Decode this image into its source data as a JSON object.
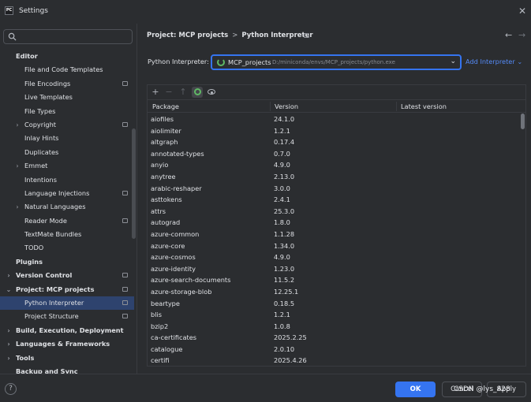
{
  "window": {
    "title": "Settings",
    "app_icon_text": "PC"
  },
  "search": {
    "placeholder": ""
  },
  "sidebar": {
    "items": [
      {
        "label": "Editor",
        "level": 0,
        "bold": true,
        "chevron": "",
        "badge": false,
        "selected": false
      },
      {
        "label": "File and Code Templates",
        "level": 1,
        "bold": false,
        "chevron": "",
        "badge": false,
        "selected": false
      },
      {
        "label": "File Encodings",
        "level": 1,
        "bold": false,
        "chevron": "",
        "badge": true,
        "selected": false
      },
      {
        "label": "Live Templates",
        "level": 1,
        "bold": false,
        "chevron": "",
        "badge": false,
        "selected": false
      },
      {
        "label": "File Types",
        "level": 1,
        "bold": false,
        "chevron": "",
        "badge": false,
        "selected": false
      },
      {
        "label": "Copyright",
        "level": 1,
        "bold": false,
        "chevron": ">",
        "badge": true,
        "selected": false
      },
      {
        "label": "Inlay Hints",
        "level": 1,
        "bold": false,
        "chevron": "",
        "badge": false,
        "selected": false
      },
      {
        "label": "Duplicates",
        "level": 1,
        "bold": false,
        "chevron": "",
        "badge": false,
        "selected": false
      },
      {
        "label": "Emmet",
        "level": 1,
        "bold": false,
        "chevron": ">",
        "badge": false,
        "selected": false
      },
      {
        "label": "Intentions",
        "level": 1,
        "bold": false,
        "chevron": "",
        "badge": false,
        "selected": false
      },
      {
        "label": "Language Injections",
        "level": 1,
        "bold": false,
        "chevron": "",
        "badge": true,
        "selected": false
      },
      {
        "label": "Natural Languages",
        "level": 1,
        "bold": false,
        "chevron": ">",
        "badge": false,
        "selected": false
      },
      {
        "label": "Reader Mode",
        "level": 1,
        "bold": false,
        "chevron": "",
        "badge": true,
        "selected": false
      },
      {
        "label": "TextMate Bundles",
        "level": 1,
        "bold": false,
        "chevron": "",
        "badge": false,
        "selected": false
      },
      {
        "label": "TODO",
        "level": 1,
        "bold": false,
        "chevron": "",
        "badge": false,
        "selected": false
      },
      {
        "label": "Plugins",
        "level": 0,
        "bold": true,
        "chevron": "",
        "badge": false,
        "selected": false
      },
      {
        "label": "Version Control",
        "level": 0,
        "bold": true,
        "chevron": ">",
        "badge": true,
        "selected": false
      },
      {
        "label": "Project: MCP projects",
        "level": 0,
        "bold": true,
        "chevron": "v",
        "badge": true,
        "selected": false
      },
      {
        "label": "Python Interpreter",
        "level": 1,
        "bold": false,
        "chevron": "",
        "badge": true,
        "selected": true
      },
      {
        "label": "Project Structure",
        "level": 1,
        "bold": false,
        "chevron": "",
        "badge": true,
        "selected": false
      },
      {
        "label": "Build, Execution, Deployment",
        "level": 0,
        "bold": true,
        "chevron": ">",
        "badge": false,
        "selected": false
      },
      {
        "label": "Languages & Frameworks",
        "level": 0,
        "bold": true,
        "chevron": ">",
        "badge": false,
        "selected": false
      },
      {
        "label": "Tools",
        "level": 0,
        "bold": true,
        "chevron": ">",
        "badge": false,
        "selected": false
      },
      {
        "label": "Backup and Sync",
        "level": 0,
        "bold": true,
        "chevron": "",
        "badge": false,
        "selected": false
      }
    ]
  },
  "breadcrumb": {
    "project": "Project: MCP projects",
    "separator": ">",
    "page": "Python Interpreter"
  },
  "interpreter": {
    "label": "Python Interpreter:",
    "name": "MCP_projects",
    "path": "D:/miniconda/envs/MCP_projects/python.exe",
    "add_label": "Add Interpreter"
  },
  "packages": {
    "headers": {
      "package": "Package",
      "version": "Version",
      "latest": "Latest version"
    },
    "rows": [
      {
        "name": "aiofiles",
        "version": "24.1.0",
        "latest": ""
      },
      {
        "name": "aiolimiter",
        "version": "1.2.1",
        "latest": ""
      },
      {
        "name": "altgraph",
        "version": "0.17.4",
        "latest": ""
      },
      {
        "name": "annotated-types",
        "version": "0.7.0",
        "latest": ""
      },
      {
        "name": "anyio",
        "version": "4.9.0",
        "latest": ""
      },
      {
        "name": "anytree",
        "version": "2.13.0",
        "latest": ""
      },
      {
        "name": "arabic-reshaper",
        "version": "3.0.0",
        "latest": ""
      },
      {
        "name": "asttokens",
        "version": "2.4.1",
        "latest": ""
      },
      {
        "name": "attrs",
        "version": "25.3.0",
        "latest": ""
      },
      {
        "name": "autograd",
        "version": "1.8.0",
        "latest": ""
      },
      {
        "name": "azure-common",
        "version": "1.1.28",
        "latest": ""
      },
      {
        "name": "azure-core",
        "version": "1.34.0",
        "latest": ""
      },
      {
        "name": "azure-cosmos",
        "version": "4.9.0",
        "latest": ""
      },
      {
        "name": "azure-identity",
        "version": "1.23.0",
        "latest": ""
      },
      {
        "name": "azure-search-documents",
        "version": "11.5.2",
        "latest": ""
      },
      {
        "name": "azure-storage-blob",
        "version": "12.25.1",
        "latest": ""
      },
      {
        "name": "beartype",
        "version": "0.18.5",
        "latest": ""
      },
      {
        "name": "blis",
        "version": "1.2.1",
        "latest": ""
      },
      {
        "name": "bzip2",
        "version": "1.0.8",
        "latest": ""
      },
      {
        "name": "ca-certificates",
        "version": "2025.2.25",
        "latest": ""
      },
      {
        "name": "catalogue",
        "version": "2.0.10",
        "latest": ""
      },
      {
        "name": "certifi",
        "version": "2025.4.26",
        "latest": ""
      }
    ]
  },
  "footer": {
    "help_label": "?",
    "ok_label": "OK",
    "cancel_label": "Cancel",
    "apply_label": "Apply",
    "watermark": "CSDN @lys_828"
  },
  "colors": {
    "accent": "#3574f0",
    "link": "#548af7",
    "selection": "#2e436e",
    "spinner": "#5fb865",
    "background": "#2b2d30"
  }
}
